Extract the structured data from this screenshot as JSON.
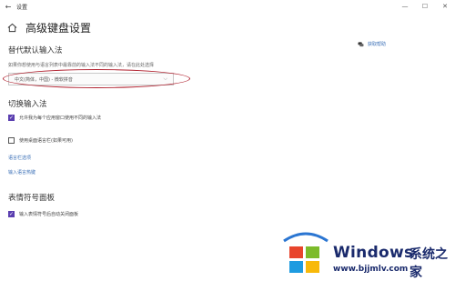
{
  "window": {
    "back_glyph": "←",
    "title": "设置",
    "min_glyph": "—",
    "max_glyph": "☐",
    "close_glyph": "✕"
  },
  "page": {
    "title": "高级键盘设置"
  },
  "override_input": {
    "section_title": "替代默认输入法",
    "description": "如果你想使用与语言列表中最靠前的输入法不同的输入法，请在此处选择",
    "dropdown_value": "中文(简体，中国) - 微软拼音",
    "chevron_glyph": "⌵"
  },
  "switch_input": {
    "section_title": "切换输入法",
    "checkbox1_label": "允许我为每个应用窗口使用不同的输入法",
    "checkbox1_checked": true,
    "checkbox2_label": "使用桌面语言栏(如果可用)",
    "checkbox2_checked": false,
    "link1": "语言栏选项",
    "link2": "输入语言热键"
  },
  "emoji_panel": {
    "section_title": "表情符号面板",
    "checkbox_label": "输入表情符号后自动关闭面板",
    "checkbox_checked": true
  },
  "help": {
    "label": "获取帮助",
    "icon": "chat-help-icon"
  },
  "watermark": {
    "brand": "Windows",
    "chinese": "系统之家",
    "url": "www.bjjmlv.com"
  },
  "colors": {
    "accent": "#5b3fb0",
    "link": "#3a6fb6",
    "annotation": "#b0202e",
    "watermark_blue": "#1a2a6c"
  }
}
